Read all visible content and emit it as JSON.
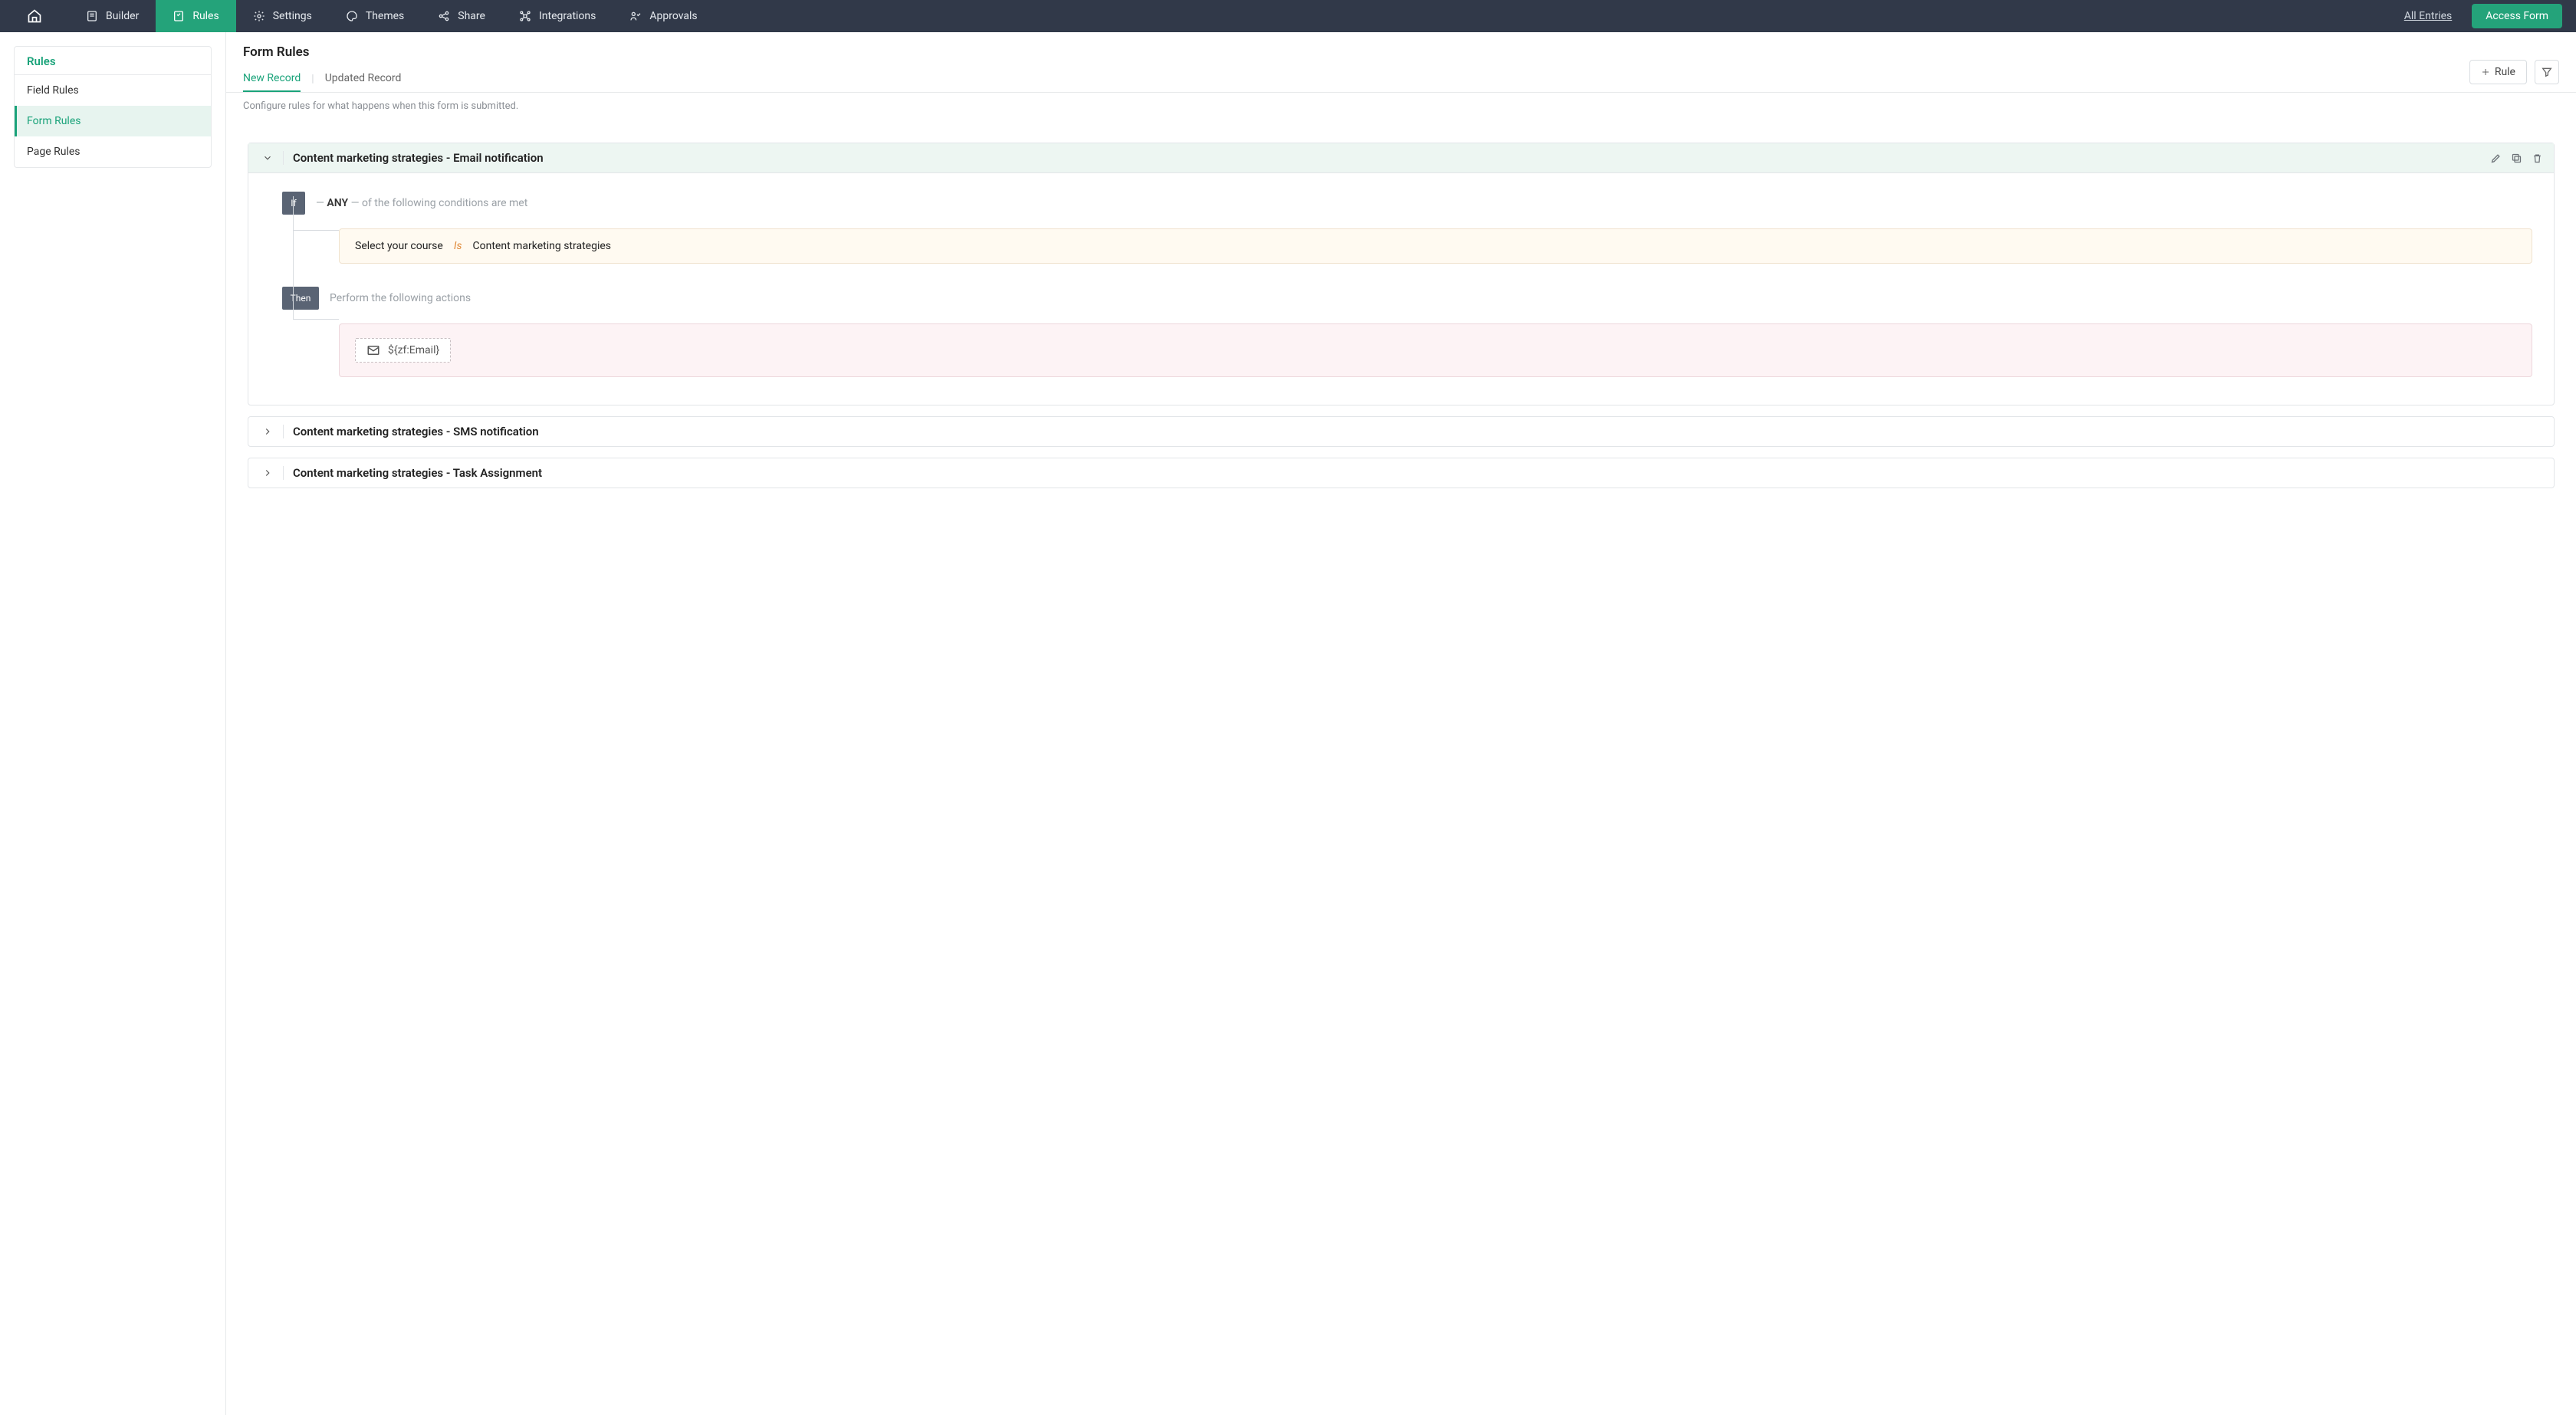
{
  "topnav": {
    "items": [
      {
        "label": "Builder"
      },
      {
        "label": "Rules"
      },
      {
        "label": "Settings"
      },
      {
        "label": "Themes"
      },
      {
        "label": "Share"
      },
      {
        "label": "Integrations"
      },
      {
        "label": "Approvals"
      }
    ],
    "all_entries": "All Entries",
    "access_form": "Access Form"
  },
  "sidebar": {
    "title": "Rules",
    "items": [
      {
        "label": "Field Rules"
      },
      {
        "label": "Form Rules"
      },
      {
        "label": "Page Rules"
      }
    ]
  },
  "main": {
    "title": "Form Rules",
    "tabs": {
      "new": "New Record",
      "updated": "Updated Record"
    },
    "rule_btn": "Rule",
    "description": "Configure rules for what happens when this form is submitted."
  },
  "rules": [
    {
      "title": "Content marketing strategies - Email notification",
      "expanded": true,
      "if_label": "If",
      "if_text_pre": "—",
      "if_any": "ANY",
      "if_text_post": "— of the following conditions are met",
      "condition": {
        "field": "Select your course",
        "op": "Is",
        "value": "Content marketing strategies"
      },
      "then_label": "Then",
      "then_text": "Perform the following actions",
      "action_email": "${zf:Email}"
    },
    {
      "title": "Content marketing strategies - SMS notification",
      "expanded": false
    },
    {
      "title": "Content marketing strategies - Task Assignment",
      "expanded": false
    }
  ]
}
